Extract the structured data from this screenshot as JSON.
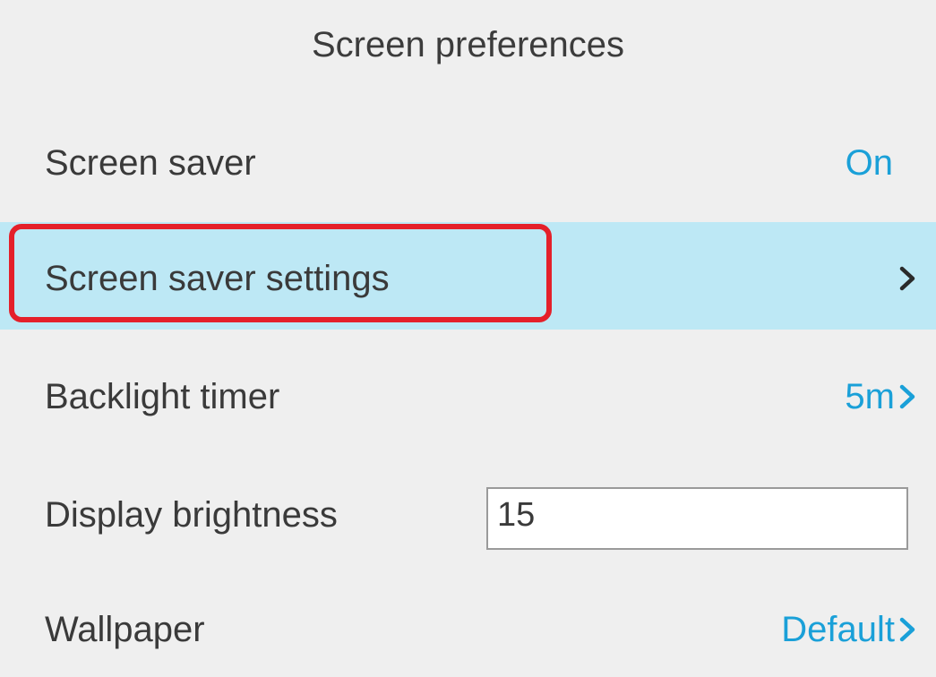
{
  "header": {
    "title": "Screen preferences"
  },
  "rows": {
    "screen_saver": {
      "label": "Screen saver",
      "value": "On"
    },
    "screen_saver_settings": {
      "label": "Screen saver settings",
      "icon": "chevron-right-icon",
      "selected": true
    },
    "backlight_timer": {
      "label": "Backlight timer",
      "value": "5m",
      "icon": "chevron-right-icon"
    },
    "display_brightness": {
      "label": "Display brightness",
      "value": "15"
    },
    "wallpaper": {
      "label": "Wallpaper",
      "value": "Default",
      "icon": "chevron-right-icon"
    }
  },
  "colors": {
    "background": "#efefef",
    "selected_row": "#bde8f5",
    "accent": "#1aa0d8",
    "highlight_border": "#e4202a",
    "text": "#3a3a3a"
  }
}
